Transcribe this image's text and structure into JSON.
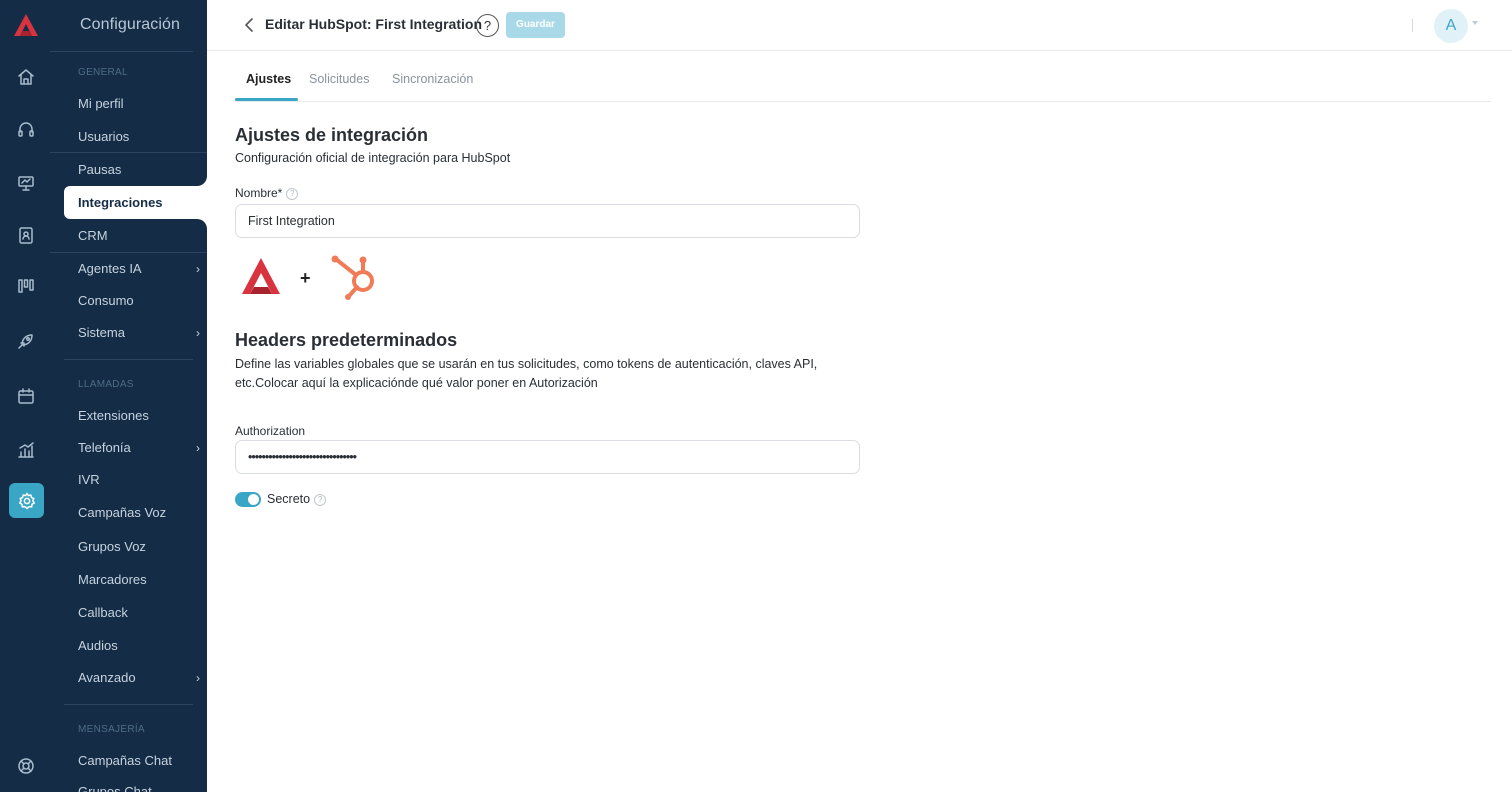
{
  "sidebar": {
    "title": "Configuración",
    "sections": {
      "general": "GENERAL",
      "llamadas": "LLAMADAS",
      "mensajeria": "MENSAJERÍA"
    },
    "items": {
      "mi_perfil": "Mi perfil",
      "usuarios": "Usuarios",
      "pausas": "Pausas",
      "integraciones": "Integraciones",
      "crm": "CRM",
      "agentes_ia": "Agentes IA",
      "consumo": "Consumo",
      "sistema": "Sistema",
      "extensiones": "Extensiones",
      "telefonia": "Telefonía",
      "ivr": "IVR",
      "campanas_voz": "Campañas Voz",
      "grupos_voz": "Grupos Voz",
      "marcadores": "Marcadores",
      "callback": "Callback",
      "audios": "Audios",
      "avanzado": "Avanzado",
      "campanas_chat": "Campañas Chat",
      "grupos_chat": "Grupos Chat"
    },
    "active_item": "Integraciones",
    "chevron": "›"
  },
  "rail": {
    "icons": [
      "logo-icon",
      "home-icon",
      "headset-icon",
      "monitor-icon",
      "contacts-icon",
      "kanban-icon",
      "rocket-icon",
      "calendar-icon",
      "analytics-icon",
      "gear-icon",
      "support-icon"
    ],
    "active": "gear-icon"
  },
  "header": {
    "title": "Editar HubSpot: First Integration",
    "help": "?",
    "save_label": "Guardar",
    "avatar_initial": "A"
  },
  "tabs": [
    "Ajustes",
    "Solicitudes",
    "Sincronización"
  ],
  "active_tab": "Ajustes",
  "settings": {
    "heading": "Ajustes de integración",
    "subtitle": "Configuración oficial de integración para HubSpot",
    "name_label": "Nombre*",
    "name_value": "First Integration",
    "plus": "+"
  },
  "headers_section": {
    "heading": "Headers predeterminados",
    "description": "Define las variables globales que se usarán en tus solicitudes, como tokens de autenticación, claves API, etc.Colocar aquí la explicaciónde qué valor poner en Autorización",
    "auth_label": "Authorization",
    "auth_value": "••••••••••••••••••••••••••••••••",
    "secret_label": "Secreto",
    "secret_enabled": true
  },
  "colors": {
    "sidebar_bg": "#142c45",
    "accent": "#3aa6c6",
    "save_disabled": "#a9d9e8",
    "hubspot": "#f07b56",
    "logo_red": "#d9333f"
  }
}
